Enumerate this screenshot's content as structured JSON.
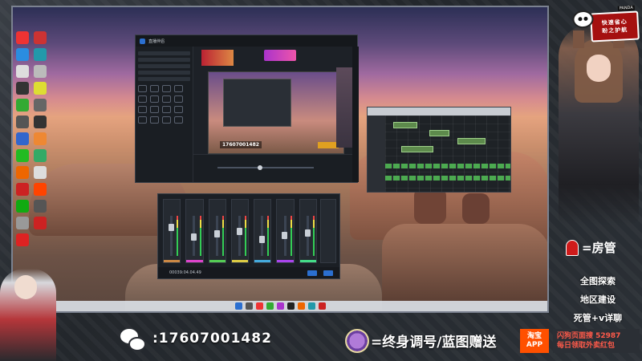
{
  "app_window": {
    "title": "直播伴侣",
    "phone_overlay": "17607001482"
  },
  "mixer": {
    "timecode": "00039:04.04.49"
  },
  "badge": {
    "brand": "PANDA",
    "line1": "快速省心",
    "line2": "盼之护航"
  },
  "right_overlay": {
    "guard_label": "=房管",
    "line1": "全图探索",
    "line2": "地区建设",
    "line3": "死管+v详聊"
  },
  "bottom": {
    "phone": ":17607001482",
    "promo": "=终身调号/蓝图赠送",
    "taobao_line1": "淘宝",
    "taobao_line2": "APP",
    "search_line1": "闪狗页面搜 52987",
    "search_line2": "每日领取外卖红包"
  },
  "colors": {
    "accent_red": "#a51010",
    "taobao_orange": "#ff5000",
    "wechat_green": "#2ea043"
  }
}
